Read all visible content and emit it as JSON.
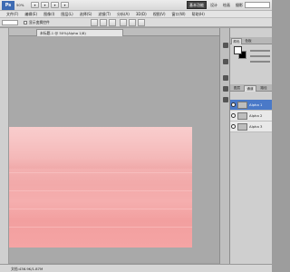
{
  "app": {
    "logo": "Ps",
    "zoom": "50%",
    "workspace_buttons": [
      "基本功能",
      "设计",
      "绘画",
      "摄影"
    ]
  },
  "menu": [
    "文件(F)",
    "编辑(E)",
    "图像(I)",
    "图层(L)",
    "选择(S)",
    "滤镜(T)",
    "分析(A)",
    "3D(D)",
    "视图(V)",
    "窗口(W)",
    "帮助(H)"
  ],
  "options": {
    "tool_select": "",
    "checkbox_label": "显示变换控件"
  },
  "document": {
    "tab_title": "未标题-1 @ 50%(Alpha 1/8)",
    "image_colors": {
      "tint": "#f4b0b0"
    }
  },
  "status": {
    "text": "文档:436.9K/1.87M"
  },
  "panels": {
    "color_tabs": [
      "颜色",
      "色板"
    ],
    "channel_tabs": [
      "图层",
      "通道",
      "路径"
    ],
    "channels": [
      "Alpha 1",
      "Alpha 2",
      "Alpha 3"
    ],
    "selected_channel": "Alpha 1",
    "accent": "#4a79c8"
  }
}
